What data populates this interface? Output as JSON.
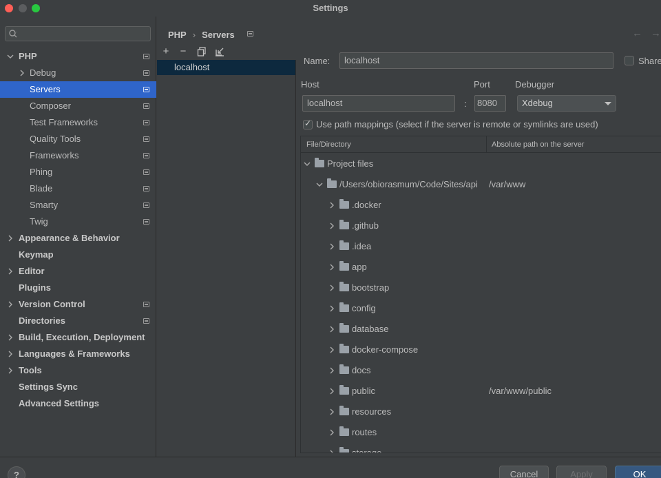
{
  "window": {
    "title": "Settings"
  },
  "sidebar": {
    "search_placeholder": "",
    "items": [
      {
        "label": "PHP",
        "level": 0,
        "expanded": true,
        "bold": true,
        "project_icon": true
      },
      {
        "label": "Debug",
        "level": 1,
        "collapsed": true,
        "project_icon": true
      },
      {
        "label": "Servers",
        "level": 1,
        "selected": true,
        "project_icon": true
      },
      {
        "label": "Composer",
        "level": 1,
        "project_icon": true
      },
      {
        "label": "Test Frameworks",
        "level": 1,
        "project_icon": true
      },
      {
        "label": "Quality Tools",
        "level": 1,
        "project_icon": true
      },
      {
        "label": "Frameworks",
        "level": 1,
        "project_icon": true
      },
      {
        "label": "Phing",
        "level": 1,
        "project_icon": true
      },
      {
        "label": "Blade",
        "level": 1,
        "project_icon": true
      },
      {
        "label": "Smarty",
        "level": 1,
        "project_icon": true
      },
      {
        "label": "Twig",
        "level": 1,
        "project_icon": true
      },
      {
        "label": "Appearance & Behavior",
        "level": 0,
        "collapsed": true,
        "bold": true
      },
      {
        "label": "Keymap",
        "level": 0,
        "bold": true
      },
      {
        "label": "Editor",
        "level": 0,
        "collapsed": true,
        "bold": true
      },
      {
        "label": "Plugins",
        "level": 0,
        "bold": true
      },
      {
        "label": "Version Control",
        "level": 0,
        "collapsed": true,
        "bold": true,
        "project_icon": true
      },
      {
        "label": "Directories",
        "level": 0,
        "bold": true,
        "project_icon": true
      },
      {
        "label": "Build, Execution, Deployment",
        "level": 0,
        "collapsed": true,
        "bold": true
      },
      {
        "label": "Languages & Frameworks",
        "level": 0,
        "collapsed": true,
        "bold": true
      },
      {
        "label": "Tools",
        "level": 0,
        "collapsed": true,
        "bold": true
      },
      {
        "label": "Settings Sync",
        "level": 0,
        "bold": true
      },
      {
        "label": "Advanced Settings",
        "level": 0,
        "bold": true
      }
    ]
  },
  "breadcrumb": {
    "parent": "PHP",
    "separator": "›",
    "current": "Servers",
    "back_icon": "←",
    "forward_icon": "→"
  },
  "server_toolbar": {
    "add": "+",
    "remove": "−"
  },
  "servers": [
    {
      "label": "localhost",
      "selected": true
    }
  ],
  "form": {
    "name_label": "Name:",
    "name_value": "localhost",
    "share_label": "Share",
    "host_label": "Host",
    "host_value": "localhost",
    "port_label": "Port",
    "port_separator": ":",
    "port_value": "8080",
    "debugger_label": "Debugger",
    "debugger_value": "Xdebug",
    "path_mappings_label": "Use path mappings (select if the server is remote or symlinks are used)",
    "path_mappings_checked": true
  },
  "mappings": {
    "col_file": "File/Directory",
    "col_server": "Absolute path on the server",
    "rows": [
      {
        "name": "Project files",
        "level": 0,
        "expanded": true,
        "server_path": ""
      },
      {
        "name": "/Users/obiorasmum/Code/Sites/api",
        "level": 1,
        "expanded": true,
        "server_path": "/var/www"
      },
      {
        "name": ".docker",
        "level": 2,
        "server_path": ""
      },
      {
        "name": ".github",
        "level": 2,
        "server_path": ""
      },
      {
        "name": ".idea",
        "level": 2,
        "server_path": ""
      },
      {
        "name": "app",
        "level": 2,
        "server_path": ""
      },
      {
        "name": "bootstrap",
        "level": 2,
        "server_path": ""
      },
      {
        "name": "config",
        "level": 2,
        "server_path": ""
      },
      {
        "name": "database",
        "level": 2,
        "server_path": ""
      },
      {
        "name": "docker-compose",
        "level": 2,
        "server_path": ""
      },
      {
        "name": "docs",
        "level": 2,
        "server_path": ""
      },
      {
        "name": "public",
        "level": 2,
        "server_path": "/var/www/public"
      },
      {
        "name": "resources",
        "level": 2,
        "server_path": ""
      },
      {
        "name": "routes",
        "level": 2,
        "server_path": ""
      },
      {
        "name": "storage",
        "level": 2,
        "server_path": ""
      }
    ]
  },
  "buttons": {
    "help": "?",
    "cancel": "Cancel",
    "apply": "Apply",
    "ok": "OK"
  }
}
